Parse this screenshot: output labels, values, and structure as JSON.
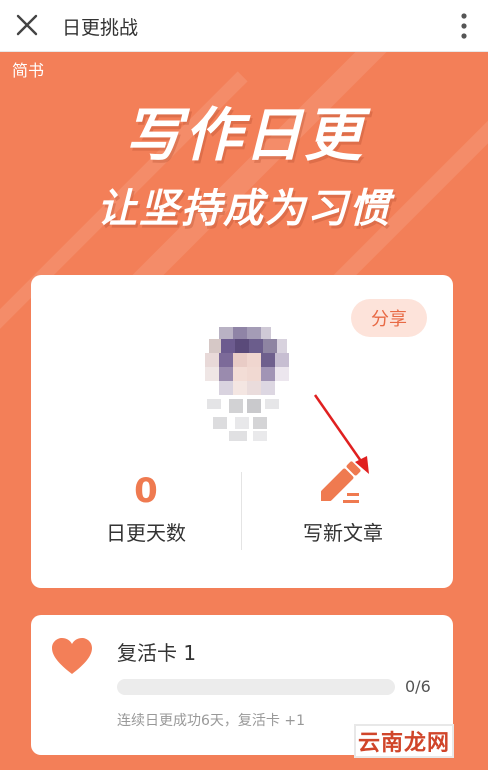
{
  "topbar": {
    "title": "日更挑战"
  },
  "hero": {
    "brand": "简书",
    "slogan_line1": "写作日更",
    "slogan_line2": "让坚持成为习惯"
  },
  "profile_card": {
    "share_label": "分享",
    "days_count": "0",
    "days_label": "日更天数",
    "write_label": "写新文章"
  },
  "revive_card": {
    "title": "复活卡 1",
    "progress_text": "0/6",
    "progress_fraction": 0,
    "description": "连续日更成功6天，复活卡 +1"
  },
  "watermark": {
    "text": "云南龙网"
  },
  "colors": {
    "accent": "#f37f58",
    "accent_dark": "#ef7a50",
    "share_bg": "#fde3da",
    "annotation_arrow": "#e02020"
  },
  "icons": [
    "close-icon",
    "more-vertical-icon",
    "pencil-icon",
    "heart-icon",
    "annotation-arrow"
  ]
}
